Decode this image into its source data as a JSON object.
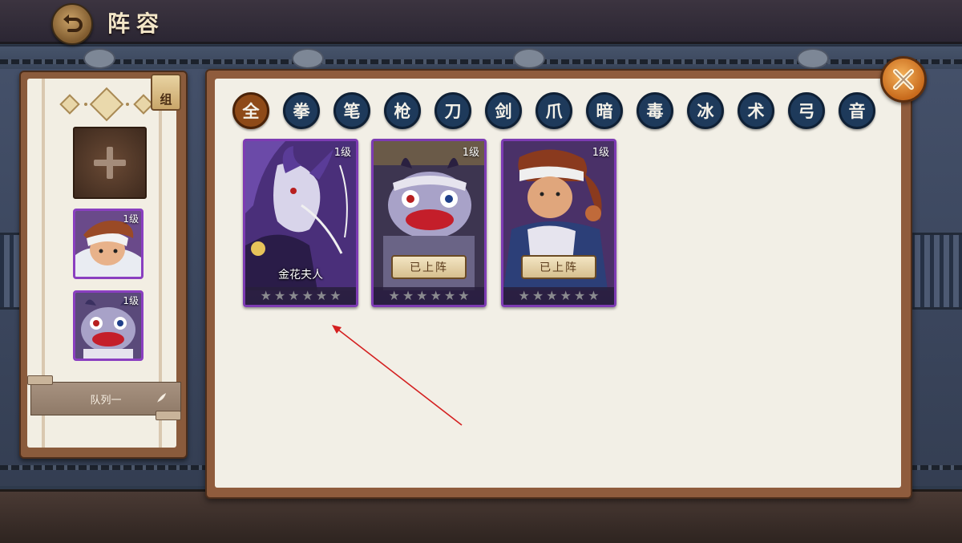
{
  "header": {
    "title": "阵容"
  },
  "team_panel": {
    "tag_label": "组",
    "slots": [
      {
        "level": "1级",
        "hero": "headband-fighter"
      },
      {
        "level": "1级",
        "hero": "blue-ogre"
      }
    ],
    "queue_label": "队列一"
  },
  "filters": [
    {
      "label": "全",
      "active": true
    },
    {
      "label": "拳",
      "active": false
    },
    {
      "label": "笔",
      "active": false
    },
    {
      "label": "枪",
      "active": false
    },
    {
      "label": "刀",
      "active": false
    },
    {
      "label": "剑",
      "active": false
    },
    {
      "label": "爪",
      "active": false
    },
    {
      "label": "暗",
      "active": false
    },
    {
      "label": "毒",
      "active": false
    },
    {
      "label": "冰",
      "active": false
    },
    {
      "label": "术",
      "active": false
    },
    {
      "label": "弓",
      "active": false
    },
    {
      "label": "音",
      "active": false
    }
  ],
  "cards": [
    {
      "level": "1级",
      "name": "金花夫人",
      "stars": 6,
      "deployed": false,
      "deployed_label": ""
    },
    {
      "level": "1级",
      "name": "",
      "stars": 6,
      "deployed": true,
      "deployed_label": "已上阵"
    },
    {
      "level": "1级",
      "name": "",
      "stars": 6,
      "deployed": true,
      "deployed_label": "已上阵"
    }
  ],
  "colors": {
    "filter_active": "#8e4a18",
    "filter_normal": "#1e3a5b",
    "card_border": "#7d3bb3",
    "annotation_arrow": "#d42020"
  },
  "icons": {
    "back": "back-arrow-icon",
    "close": "close-x-icon",
    "add": "plus-icon",
    "edit": "feather-edit-icon",
    "star": "star-icon"
  }
}
